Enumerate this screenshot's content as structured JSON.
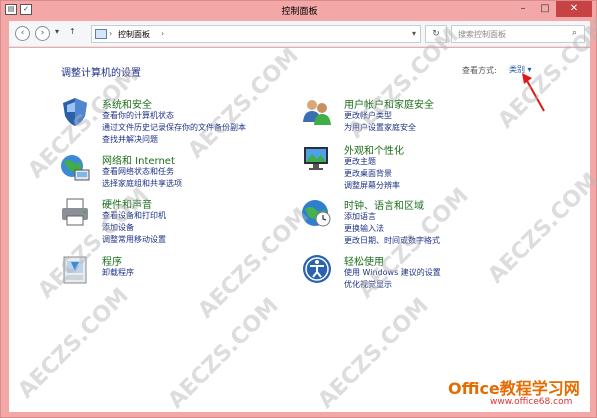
{
  "window": {
    "title": "控制面板",
    "minimize": "–",
    "maximize": "□",
    "close": "✕"
  },
  "toolbar": {
    "back": "‹",
    "forward": "›",
    "up": "↑",
    "address": "控制面板",
    "refresh": "↻",
    "search_placeholder": "搜索控制面板"
  },
  "main": {
    "heading": "调整计算机的设置",
    "view_label": "查看方式:",
    "view_value": "类别 ▾"
  },
  "categories_left": [
    {
      "title": "系统和安全",
      "icon": "shield-icon",
      "links": [
        "查看你的计算机状态",
        "通过文件历史记录保存你的文件备份副本",
        "查找并解决问题"
      ]
    },
    {
      "title": "网络和 Internet",
      "icon": "network-icon",
      "links": [
        "查看网络状态和任务",
        "选择家庭组和共享选项"
      ]
    },
    {
      "title": "硬件和声音",
      "icon": "printer-icon",
      "links": [
        "查看设备和打印机",
        "添加设备",
        "调整常用移动设置"
      ]
    },
    {
      "title": "程序",
      "icon": "programs-icon",
      "links": [
        "卸载程序"
      ]
    }
  ],
  "categories_right": [
    {
      "title": "用户帐户和家庭安全",
      "icon": "users-icon",
      "links": [
        "更改帐户类型",
        "为用户设置家庭安全"
      ]
    },
    {
      "title": "外观和个性化",
      "icon": "appearance-icon",
      "links": [
        "更改主题",
        "更改桌面背景",
        "调整屏幕分辨率"
      ]
    },
    {
      "title": "时钟、语言和区域",
      "icon": "globe-clock-icon",
      "links": [
        "添加语言",
        "更换输入法",
        "更改日期、时间或数字格式"
      ]
    },
    {
      "title": "轻松使用",
      "icon": "ease-of-access-icon",
      "links": [
        "使用 Windows 建议的设置",
        "优化视觉显示"
      ]
    }
  ],
  "watermark": "AECZS.COM",
  "brand": {
    "name": "Office教程学习网",
    "url": "www.office68.com"
  }
}
